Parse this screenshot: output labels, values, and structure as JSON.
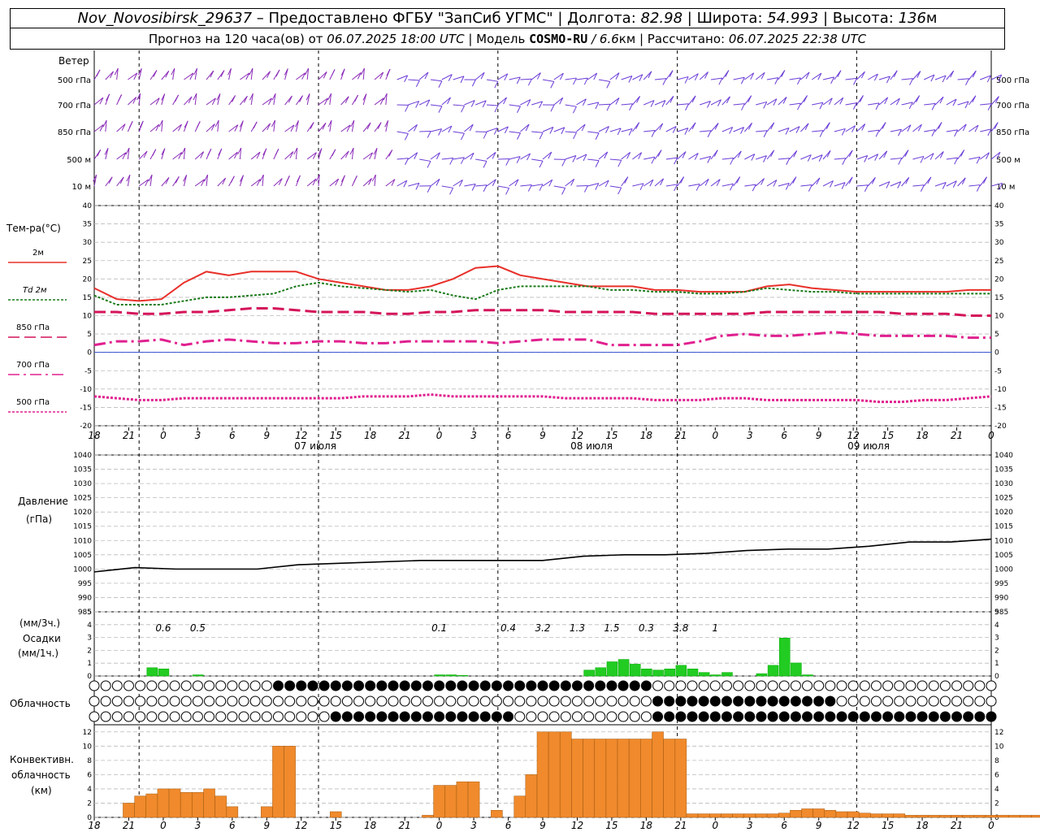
{
  "header": {
    "station": "Nov_Novosibirsk_29637",
    "dash": " – ",
    "provider_prefix": "Предоставлено ФГБУ \"ЗапСиб УГМС\"",
    "lon_label": "Долгота:",
    "lon_value": "82.98",
    "lat_label": "Широта:",
    "lat_value": "54.993",
    "alt_label": "Высота:",
    "alt_value": "136",
    "alt_unit": "м",
    "forecast_prefix": "Прогноз на 120 часа(ов) от",
    "forecast_from": "06.07.2025 18:00 UTC",
    "model_label": "Модель",
    "model_name": "COSMO-RU",
    "model_res": "/ 6.6",
    "model_res_unit": "км",
    "computed_label": "Рассчитано:",
    "computed_value": "06.07.2025 22:38 UTC"
  },
  "wind_panel": {
    "title": "Ветер",
    "levels": [
      "500 гПа",
      "700 гПа",
      "850 гПа",
      "500 м",
      "10  м"
    ]
  },
  "time_axis": {
    "ticks": [
      "18",
      "21",
      "0",
      "3",
      "6",
      "9",
      "12",
      "15",
      "18",
      "21",
      "0",
      "3",
      "6",
      "9",
      "12",
      "15",
      "18",
      "21",
      "0",
      "3",
      "6",
      "9",
      "12",
      "15",
      "18",
      "21",
      "0"
    ],
    "dates": [
      "07 июля",
      "08 июля",
      "09 июля"
    ]
  },
  "temp_panel": {
    "title": "Тем-ра(°С)",
    "legend": [
      {
        "label": "2м",
        "color": "#e8302a",
        "style": "solid"
      },
      {
        "label": "Td  2м",
        "color": "#1a7a1a",
        "style": "dotted"
      },
      {
        "label": "850 гПа",
        "color": "#d4145a",
        "style": "dash"
      },
      {
        "label": "700 гПа",
        "color": "#e0208f",
        "style": "dashdot"
      },
      {
        "label": "500 гПа",
        "color": "#e0208f",
        "style": "dotted"
      }
    ],
    "yticks": [
      "40",
      "35",
      "30",
      "25",
      "20",
      "15",
      "10",
      "5",
      "0",
      "-5",
      "-10",
      "-15",
      "-20"
    ]
  },
  "pressure_panel": {
    "title": "Давление",
    "unit": "(гПа)",
    "yticks": [
      "1040",
      "1035",
      "1030",
      "1025",
      "1020",
      "1015",
      "1010",
      "1005",
      "1000",
      "995",
      "990",
      "985"
    ]
  },
  "precip_panel": {
    "unit1": "(мм/3ч.)",
    "title": "Осадки",
    "unit2": "(мм/1ч.)",
    "yticks": [
      "5",
      "4",
      "3",
      "2",
      "1",
      "0"
    ],
    "labels": [
      {
        "h": 6,
        "text": "0.6"
      },
      {
        "h": 9,
        "text": "0.5"
      },
      {
        "h": 30,
        "text": "0.1"
      },
      {
        "h": 36,
        "text": "0.4"
      },
      {
        "h": 39,
        "text": "3.2"
      },
      {
        "h": 42,
        "text": "1.3"
      },
      {
        "h": 45,
        "text": "1.5"
      },
      {
        "h": 48,
        "text": "0.3"
      },
      {
        "h": 51,
        "text": "3.8"
      },
      {
        "h": 54,
        "text": "1"
      }
    ]
  },
  "cloud_panel": {
    "title": "Облачность"
  },
  "conv_panel": {
    "title1": "Конвективн.",
    "title2": "облачность",
    "unit": "(км)",
    "yticks": [
      "12",
      "10",
      "8",
      "6",
      "4",
      "2",
      "0"
    ]
  },
  "chart_data": [
    {
      "type": "line",
      "title": "Тем-ра(°С)",
      "x_hours_from": "06.07.2025 18:00 UTC",
      "ylim": [
        -20,
        40
      ],
      "x": [
        0,
        3,
        6,
        9,
        12,
        15,
        18,
        21,
        24,
        27,
        30,
        33,
        36,
        39,
        42,
        45,
        48,
        51,
        54,
        57,
        60,
        63,
        66,
        69,
        72,
        75,
        78,
        81,
        84,
        87,
        90,
        93,
        96,
        99,
        102,
        105,
        108,
        111,
        114,
        117,
        120
      ],
      "series": [
        {
          "name": "2м",
          "values": [
            17.5,
            14.5,
            14,
            14.5,
            19,
            22,
            21,
            22,
            22,
            22,
            20,
            19,
            18,
            17,
            17,
            18,
            20,
            23,
            23.5,
            21,
            20,
            19,
            18,
            18,
            18,
            17,
            17,
            16.5,
            16.5,
            16.5,
            18,
            18.5,
            17.5,
            17,
            16.5,
            16.5,
            16.5,
            16.5,
            16.5,
            17,
            17
          ]
        },
        {
          "name": "Td  2м",
          "values": [
            15.5,
            13,
            13,
            13,
            14,
            15,
            15,
            15.5,
            16,
            18,
            19,
            18,
            17.5,
            17,
            16.5,
            17,
            15.5,
            14.5,
            17,
            18,
            18,
            18,
            18,
            17,
            17,
            16.5,
            16.5,
            16,
            16,
            16.5,
            17.5,
            17,
            16.5,
            16.5,
            16,
            16,
            16,
            16,
            16,
            16,
            16
          ]
        },
        {
          "name": "850 гПа",
          "values": [
            11,
            11,
            10.5,
            10.5,
            11,
            11,
            11.5,
            12,
            12,
            11.5,
            11,
            11,
            11,
            10.5,
            10.5,
            11,
            11,
            11.5,
            11.5,
            11.5,
            11.5,
            11,
            11,
            11,
            11,
            10.5,
            10.5,
            10.5,
            10.5,
            10.5,
            11,
            11,
            11,
            11,
            11,
            11,
            10.5,
            10.5,
            10.5,
            10,
            10
          ]
        },
        {
          "name": "700 гПа",
          "values": [
            2,
            3,
            3,
            3.5,
            2,
            3,
            3.5,
            3,
            2.5,
            2.5,
            3,
            3,
            2.5,
            2.5,
            3,
            3,
            3,
            3,
            2.5,
            3,
            3.5,
            3.5,
            3.5,
            2,
            2,
            2,
            2,
            3,
            4.5,
            5,
            4.5,
            4.5,
            5,
            5.5,
            5,
            4.5,
            4.5,
            4.5,
            4.5,
            4,
            4
          ]
        },
        {
          "name": "500 гПа",
          "values": [
            -12,
            -12.5,
            -13,
            -13,
            -12.5,
            -12.5,
            -12.5,
            -12.5,
            -12.5,
            -12.5,
            -12.5,
            -12.5,
            -12,
            -12,
            -12,
            -11.5,
            -12,
            -12,
            -12,
            -12,
            -12,
            -12.5,
            -12.5,
            -12.5,
            -12.5,
            -13,
            -13,
            -13,
            -12.5,
            -12.5,
            -13,
            -13,
            -13,
            -13,
            -13,
            -13.5,
            -13.5,
            -13,
            -13,
            -12.5,
            -12
          ]
        }
      ]
    },
    {
      "type": "line",
      "title": "Давление",
      "ylim": [
        985,
        1040
      ],
      "x": [
        0,
        6,
        12,
        18,
        24,
        30,
        36,
        42,
        48,
        54,
        60,
        66,
        72,
        78,
        84,
        90,
        96,
        102,
        108,
        114,
        120
      ],
      "series": [
        {
          "name": "Давление",
          "values": [
            999,
            1000.5,
            1000,
            1000,
            1000,
            1001.5,
            1002,
            1002.5,
            1003,
            1003,
            1003,
            1003,
            1004.5,
            1005,
            1005,
            1005.5,
            1006.5,
            1007,
            1007,
            1008,
            1009.5,
            1009.5,
            1010.5
          ]
        }
      ]
    },
    {
      "type": "bar",
      "title": "Осадки",
      "ylim": [
        0,
        5
      ],
      "x": [
        5,
        6,
        9,
        10,
        30,
        31,
        32,
        34,
        35,
        36,
        37,
        38,
        39,
        40,
        41,
        42,
        43,
        44,
        45,
        46,
        47,
        48,
        49,
        50,
        51,
        52,
        53,
        54,
        55,
        56,
        57,
        58,
        59,
        60,
        61,
        62,
        63,
        64
      ],
      "values": [
        0.7,
        0.6,
        0.1,
        0.0,
        0.1,
        0.1,
        0.05,
        0,
        0,
        0,
        0,
        0,
        0,
        0,
        0,
        0,
        0.5,
        0.7,
        1.2,
        1.4,
        1.0,
        0.6,
        0.5,
        0.6,
        0.9,
        0.6,
        0.3,
        0.1,
        0.3,
        0,
        0,
        0.2,
        0.9,
        3.2,
        1.1,
        0.1,
        0,
        0
      ]
    },
    {
      "type": "bar",
      "title": "Конвективн. облачность",
      "ylim": [
        0,
        13
      ],
      "x": [
        3,
        4,
        5,
        6,
        7,
        8,
        9,
        10,
        11,
        12,
        15,
        16,
        17,
        21,
        29,
        30,
        31,
        32,
        33,
        35,
        37,
        38,
        39,
        40,
        41,
        42,
        43,
        44,
        45,
        46,
        47,
        48,
        49,
        50,
        51,
        52,
        53,
        54,
        55,
        56,
        57,
        58,
        59,
        60,
        61,
        62,
        63,
        64,
        65,
        66,
        67,
        68,
        69,
        70,
        71,
        72,
        73,
        74,
        75,
        76,
        77,
        78,
        79,
        80,
        81,
        82,
        84
      ],
      "values": [
        2,
        3,
        3.3,
        4,
        4,
        3.5,
        3.5,
        4,
        3,
        1.5,
        1.5,
        10,
        10,
        0.8,
        0.3,
        4.5,
        4.5,
        5,
        5,
        1,
        3,
        6,
        12,
        12,
        12,
        11,
        11,
        11,
        11,
        11,
        11,
        11,
        12,
        11,
        11,
        0.5,
        0.5,
        0.5,
        0.5,
        0.5,
        0.5,
        0.5,
        0.5,
        0.6,
        1,
        1.2,
        1.2,
        1,
        0.8,
        0.8,
        0.6,
        0.5,
        0.5,
        0.5,
        0.3,
        0.3,
        0.3,
        0.3,
        0.3,
        0.3,
        0.3,
        0.3,
        0.3,
        0.3,
        0.3,
        0.3,
        0.3
      ]
    }
  ]
}
